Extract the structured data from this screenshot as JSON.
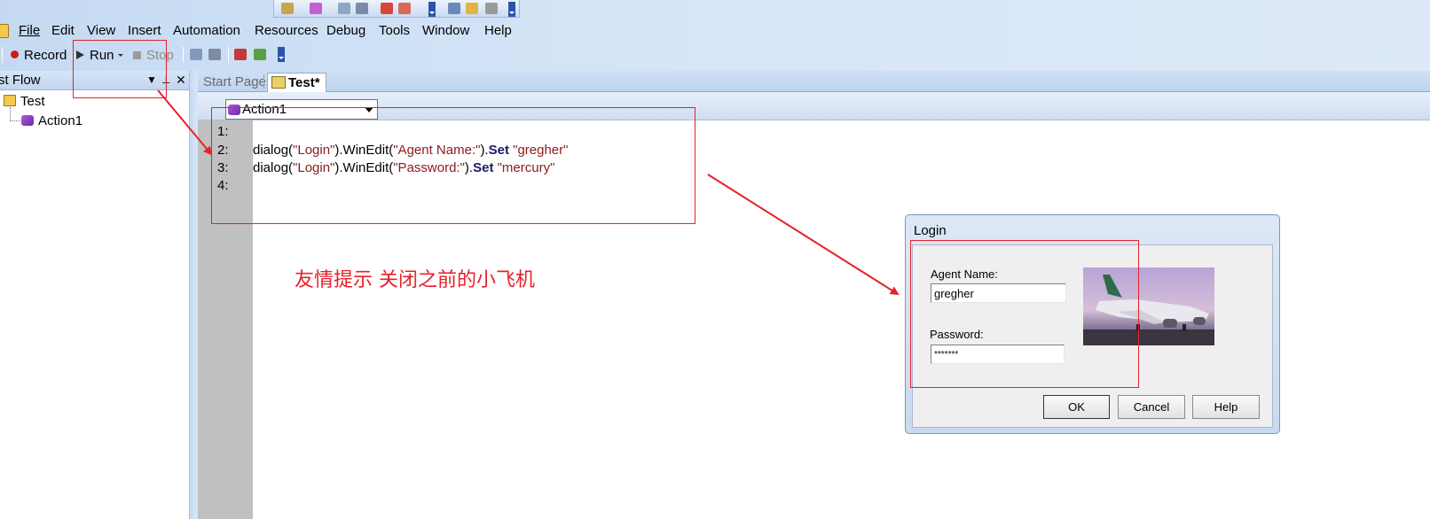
{
  "menu": {
    "items": [
      "File",
      "Edit",
      "View",
      "Insert",
      "Automation",
      "Resources",
      "Debug",
      "Tools",
      "Window",
      "Help"
    ]
  },
  "toolbar": {
    "record": "Record",
    "run": "Run",
    "stop": "Stop"
  },
  "left_pane": {
    "title": "st Flow",
    "tree": {
      "root": "Test",
      "child": "Action1"
    }
  },
  "tabs": [
    {
      "label": "Start Page",
      "active": false
    },
    {
      "label": "Test*",
      "active": true
    }
  ],
  "editor": {
    "action_selector": "Action1",
    "lines": [
      {
        "num": "1:",
        "code": ""
      },
      {
        "num": "2:",
        "obj": "dialog(",
        "s1": "\"Login\"",
        "mid": ").WinEdit(",
        "s2": "\"Agent Name:\"",
        "close": ").",
        "method": "Set",
        "val": " \"gregher\""
      },
      {
        "num": "3:",
        "obj": "dialog(",
        "s1": "\"Login\"",
        "mid": ").WinEdit(",
        "s2": "\"Password:\"",
        "close": ").",
        "method": "Set",
        "val": " \"mercury\""
      },
      {
        "num": "4:",
        "code": ""
      }
    ]
  },
  "annotation": {
    "note": "友情提示 关闭之前的小飞机",
    "color": "#e8202a"
  },
  "dialog": {
    "title": "Login",
    "agent_label": "Agent Name:",
    "agent_value": "gregher",
    "password_label": "Password:",
    "password_value": "*******",
    "ok": "OK",
    "cancel": "Cancel",
    "help": "Help"
  }
}
